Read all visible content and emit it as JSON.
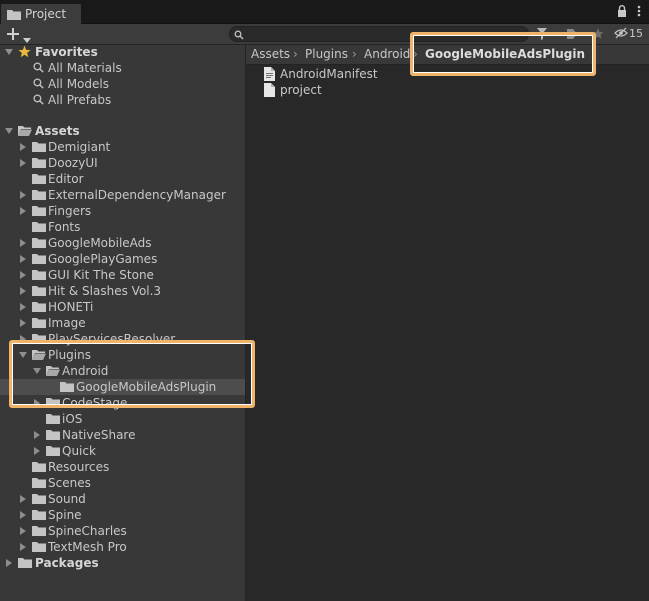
{
  "tab": {
    "title": "Project"
  },
  "toolbar": {
    "search_placeholder": "",
    "hidden_count": "15"
  },
  "tree": {
    "favorites": {
      "label": "Favorites",
      "items": [
        {
          "label": "All Materials"
        },
        {
          "label": "All Models"
        },
        {
          "label": "All Prefabs"
        }
      ]
    },
    "assets": {
      "label": "Assets"
    },
    "folders": [
      {
        "label": "Demigiant"
      },
      {
        "label": "DoozyUI"
      },
      {
        "label": "Editor"
      },
      {
        "label": "ExternalDependencyManager"
      },
      {
        "label": "Fingers"
      },
      {
        "label": "Fonts"
      },
      {
        "label": "GoogleMobileAds"
      },
      {
        "label": "GooglePlayGames"
      },
      {
        "label": "GUI Kit The Stone"
      },
      {
        "label": "Hit & Slashes Vol.3"
      },
      {
        "label": "HONETi"
      },
      {
        "label": "Image"
      },
      {
        "label": "PlayServicesResolver"
      },
      {
        "label": "Plugins"
      },
      {
        "label": "Android"
      },
      {
        "label": "GoogleMobileAdsPlugin"
      },
      {
        "label": "CodeStage"
      },
      {
        "label": "iOS"
      },
      {
        "label": "NativeShare"
      },
      {
        "label": "Quick"
      },
      {
        "label": "Resources"
      },
      {
        "label": "Scenes"
      },
      {
        "label": "Sound"
      },
      {
        "label": "Spine"
      },
      {
        "label": "SpineCharles"
      },
      {
        "label": "TextMesh Pro"
      }
    ],
    "packages": {
      "label": "Packages"
    }
  },
  "breadcrumb": [
    "Assets",
    "Plugins",
    "Android",
    "GoogleMobileAdsPlugin"
  ],
  "files": [
    {
      "label": "AndroidManifest"
    },
    {
      "label": "project"
    }
  ],
  "colors": {
    "highlight": "#f0b36a",
    "favorite_star": "#e8b93c",
    "folder": "#c4c4c4"
  }
}
